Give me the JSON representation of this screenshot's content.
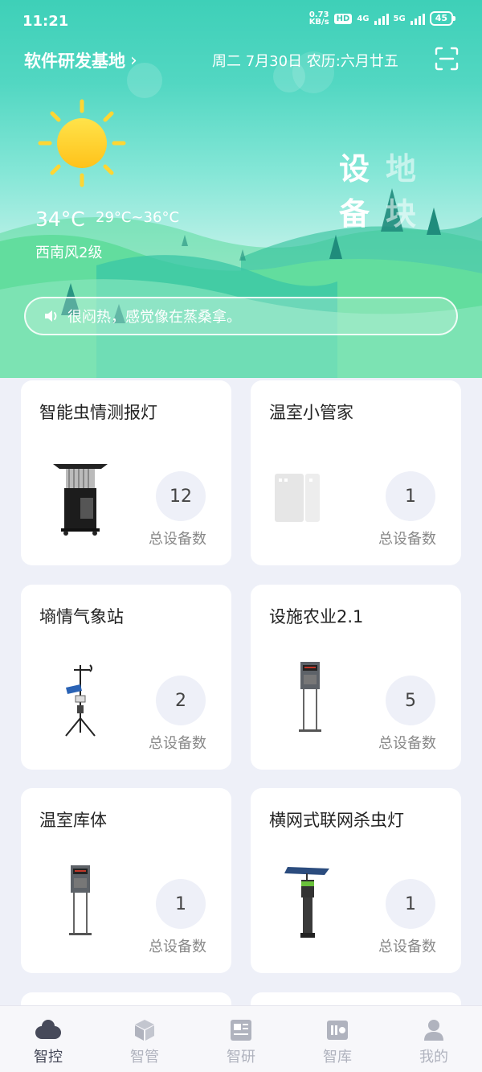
{
  "status_bar": {
    "time": "11:21",
    "net_speed_value": "0.73",
    "net_speed_unit": "KB/s",
    "hd_label": "HD",
    "signal_1_label": "4G",
    "signal_2_label": "5G",
    "battery": "45"
  },
  "header": {
    "location": "软件研发基地",
    "date": "周二 7月30日 农历:六月廿五"
  },
  "weather": {
    "temp": "34°C",
    "temp_range": "29°C~36°C",
    "wind": "西南风2级",
    "tip": "很闷热，感觉像在蒸桑拿。"
  },
  "view_toggle": {
    "active": [
      "设",
      "备"
    ],
    "inactive": [
      "地",
      "块"
    ]
  },
  "cards": [
    {
      "title": "智能虫情测报灯",
      "count": "12",
      "count_label": "总设备数"
    },
    {
      "title": "温室小管家",
      "count": "1",
      "count_label": "总设备数"
    },
    {
      "title": "墒情气象站",
      "count": "2",
      "count_label": "总设备数"
    },
    {
      "title": "设施农业2.1",
      "count": "5",
      "count_label": "总设备数"
    },
    {
      "title": "温室库体",
      "count": "1",
      "count_label": "总设备数"
    },
    {
      "title": "横网式联网杀虫灯",
      "count": "1",
      "count_label": "总设备数"
    }
  ],
  "tabs": [
    {
      "label": "智控",
      "icon": "cloud-icon",
      "active": true
    },
    {
      "label": "智管",
      "icon": "cube-icon",
      "active": false
    },
    {
      "label": "智研",
      "icon": "news-icon",
      "active": false
    },
    {
      "label": "智库",
      "icon": "library-icon",
      "active": false
    },
    {
      "label": "我的",
      "icon": "user-icon",
      "active": false
    }
  ],
  "colors": {
    "accent": "#3ed0b8",
    "active_tab": "#474a5a",
    "inactive_tab": "#b0b3be",
    "page_bg": "#eef0f8"
  }
}
